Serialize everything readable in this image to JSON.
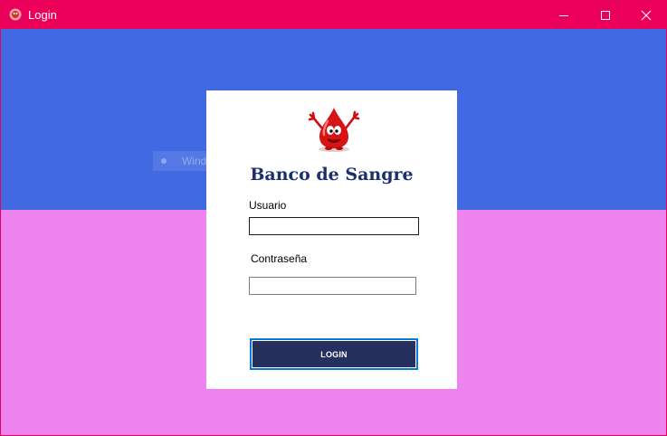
{
  "window": {
    "title": "Login",
    "controls": {
      "minimize": "minimize-icon",
      "maximize": "maximize-icon",
      "close": "close-icon"
    },
    "colors": {
      "titlebar": "#ea0058",
      "top_band": "#4169e1",
      "bottom_band": "#ee82ee"
    }
  },
  "overlay": {
    "ghost_text": "Window Snip"
  },
  "login": {
    "logo": "blood-drop-mascot",
    "heading": "Banco de Sangre",
    "user_label": "Usuario",
    "user_value": "",
    "password_label": "Contraseña",
    "password_value": "",
    "button_label": "LOGIN",
    "colors": {
      "heading": "#1a2f6e",
      "button": "#25305e",
      "button_focus": "#0a78d7"
    }
  }
}
